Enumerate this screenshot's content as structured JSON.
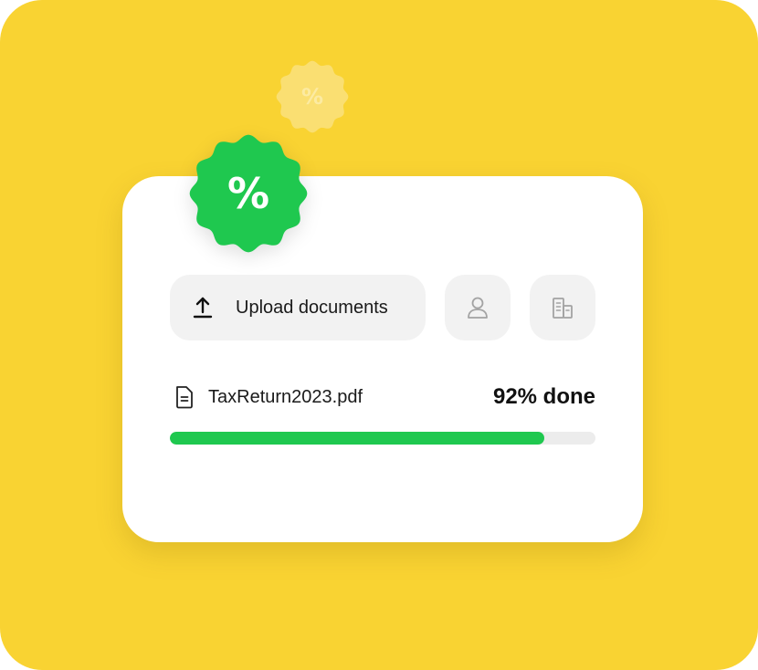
{
  "badges": {
    "small": {
      "symbol": "%",
      "icon": "percent-badge-icon"
    },
    "large": {
      "symbol": "%",
      "icon": "percent-badge-icon"
    }
  },
  "upload": {
    "label": "Upload documents",
    "icon": "upload-icon"
  },
  "actions": [
    {
      "icon": "user-icon"
    },
    {
      "icon": "building-icon"
    }
  ],
  "file": {
    "icon": "document-icon",
    "name": "TaxReturn2023.pdf",
    "progress_label": "92% done",
    "progress_fraction": 0.88
  },
  "colors": {
    "background": "#f9d332",
    "card": "#ffffff",
    "accent_green": "#1fc84f",
    "badge_green": "#22c55e",
    "button_bg": "#f2f2f2",
    "track": "#ececec"
  }
}
